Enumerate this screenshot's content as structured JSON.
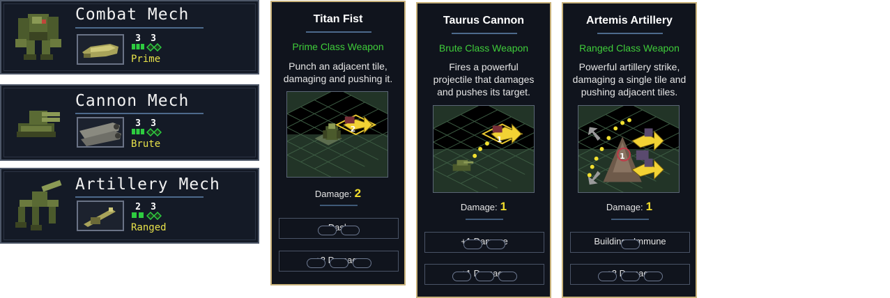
{
  "mechs": [
    {
      "name": "Combat Mech",
      "move": "3",
      "health": "3",
      "weapon_class": "Prime"
    },
    {
      "name": "Cannon Mech",
      "move": "3",
      "health": "3",
      "weapon_class": "Brute"
    },
    {
      "name": "Artillery Mech",
      "move": "2",
      "health": "3",
      "weapon_class": "Ranged"
    }
  ],
  "weapons": [
    {
      "title": "Titan Fist",
      "class": "Prime Class Weapon",
      "desc": [
        "Punch an adjacent tile,",
        "damaging and pushing it."
      ],
      "damage_label": "Damage:",
      "damage": "2",
      "upgrades": [
        {
          "label": "Dash",
          "cost": 2
        },
        {
          "label": "+2 Damage",
          "cost": 3
        }
      ]
    },
    {
      "title": "Taurus Cannon",
      "class": "Brute Class Weapon",
      "desc": [
        "Fires a powerful",
        "projectile that damages",
        "and pushes its target."
      ],
      "damage_label": "Damage:",
      "damage": "1",
      "upgrades": [
        {
          "label": "+1 Damage",
          "cost": 2
        },
        {
          "label": "+1 Damage",
          "cost": 3
        }
      ]
    },
    {
      "title": "Artemis Artillery",
      "class": "Ranged Class Weapon",
      "desc": [
        "Powerful artillery strike,",
        "damaging a single tile and",
        "pushing adjacent tiles."
      ],
      "damage_label": "Damage:",
      "damage": "1",
      "upgrades": [
        {
          "label": "Buildings Immune",
          "cost": 1
        },
        {
          "label": "+2 Damage",
          "cost": 3
        }
      ]
    }
  ],
  "preview_damage": [
    "2",
    "1",
    "1"
  ],
  "colors": {
    "panel_bg": "#141a26",
    "card_border": "#c9b27a",
    "class_green": "#3fcd3a",
    "damage_yellow": "#f3de2d",
    "mech_class_yellow": "#e8e24a"
  },
  "icons": {
    "move": "move-bars-icon",
    "health": "health-diamond-icon"
  }
}
